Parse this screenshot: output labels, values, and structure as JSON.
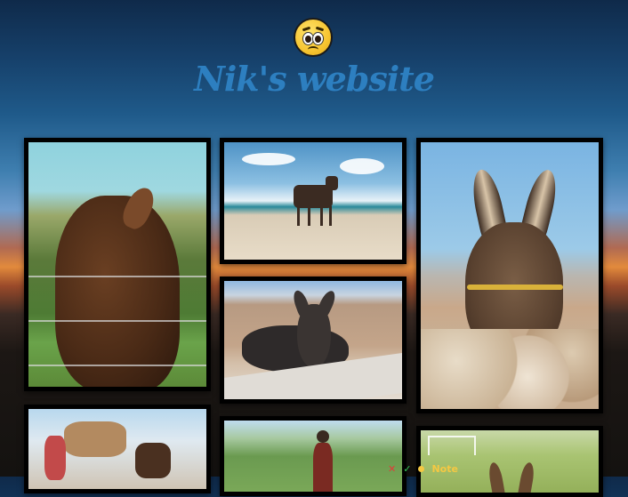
{
  "header": {
    "emoji_icon": "pleading-face-icon",
    "title": "Nik's website"
  },
  "gallery": {
    "photos": [
      {
        "subject": "donkey-by-fence"
      },
      {
        "subject": "donkey-on-beach"
      },
      {
        "subject": "donkey-behind-wall"
      },
      {
        "subject": "donkey-portrait-with-halter"
      },
      {
        "subject": "loaded-pack-donkey"
      },
      {
        "subject": "person-on-hillside"
      },
      {
        "subject": "donkey-ears-field"
      }
    ]
  },
  "annotation_toolbar": {
    "close_icon": "close-icon",
    "check_icon": "check-icon",
    "note_label": "Note"
  }
}
